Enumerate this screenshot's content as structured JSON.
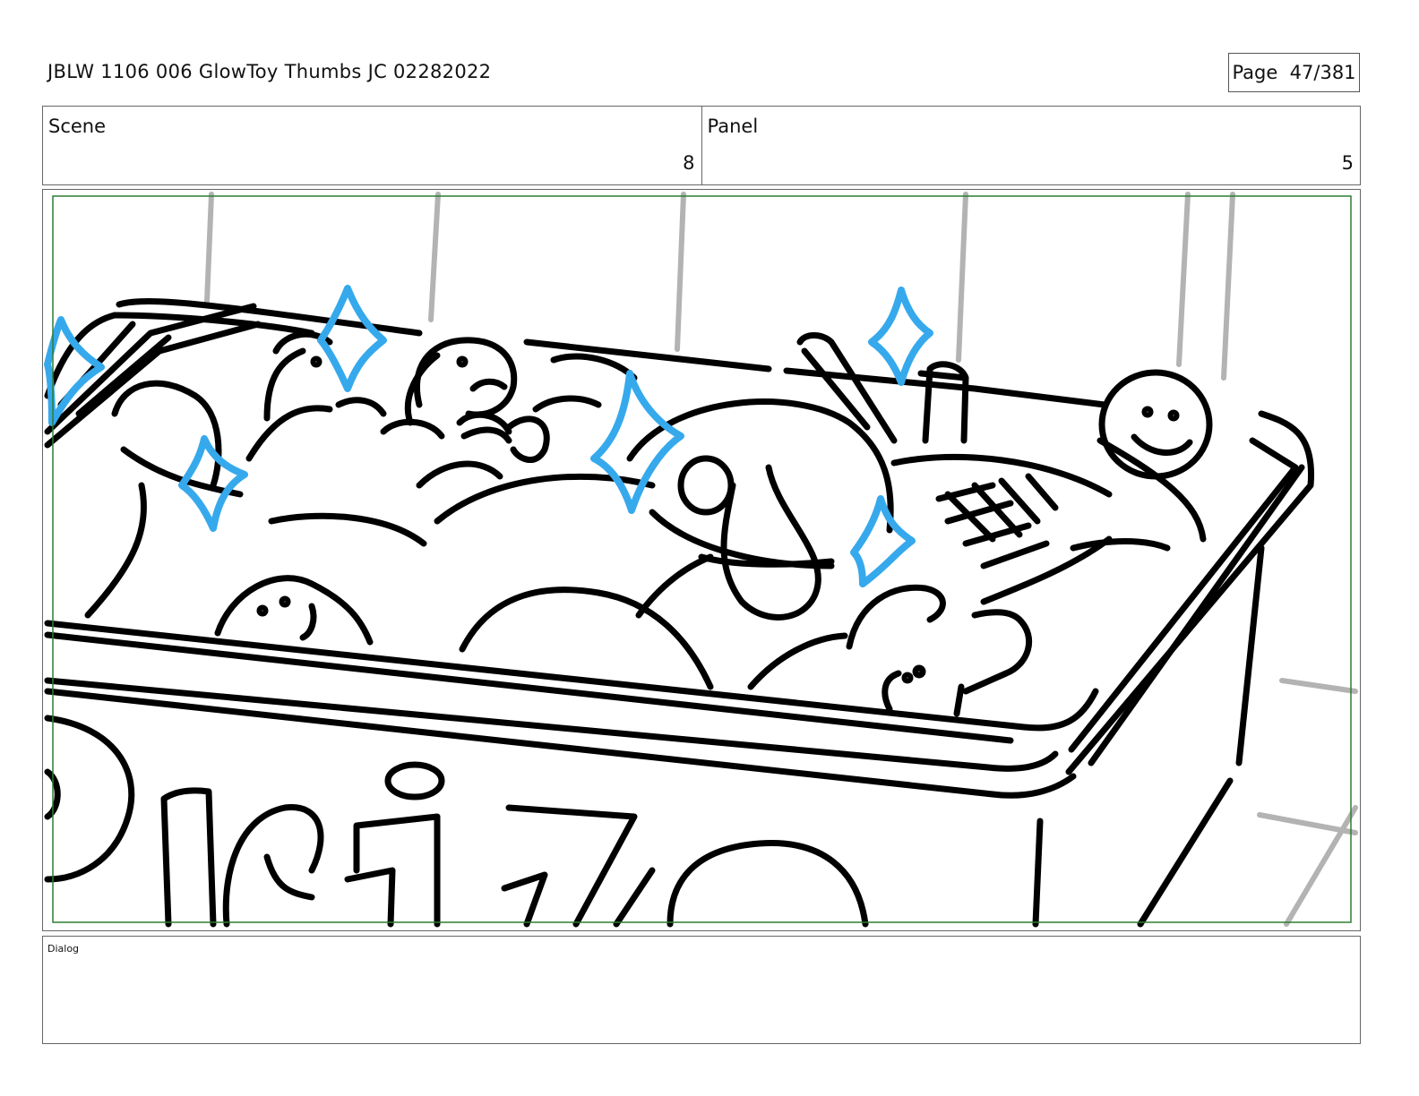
{
  "header": {
    "document_title": "JBLW 1106 006 GlowToy Thumbs JC 02282022",
    "page_label": "Page",
    "page_number": "47/381"
  },
  "meta": {
    "scene_label": "Scene",
    "scene_value": "8",
    "panel_label": "Panel",
    "panel_value": "5"
  },
  "dialog": {
    "label": "Dialog",
    "text": ""
  },
  "colors": {
    "ink": "#000000",
    "sparkle": "#36a9ec",
    "background_lines": "#b3b3b3",
    "safe_frame": "#2e7d32"
  }
}
